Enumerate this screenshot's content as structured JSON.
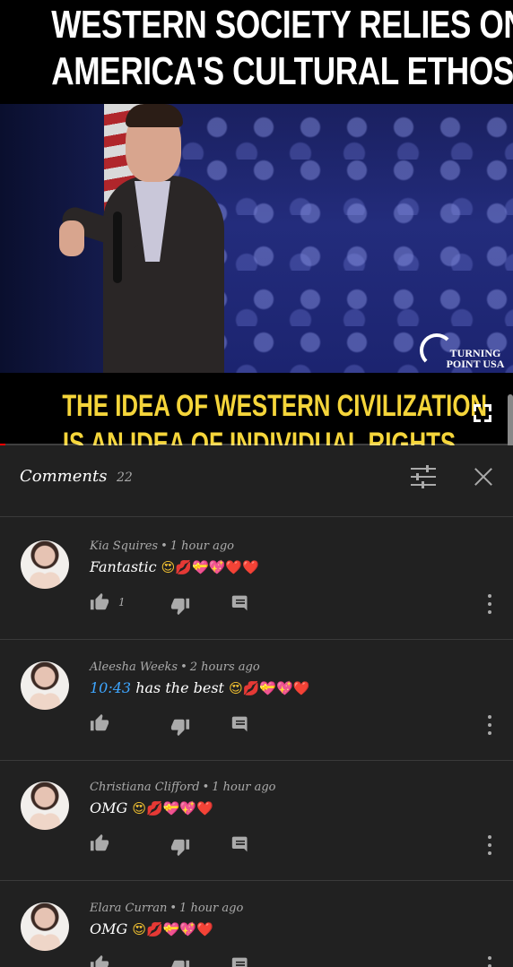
{
  "video": {
    "headline_line1": "WESTERN SOCIETY RELIES ON",
    "headline_line2": "AMERICA'S CULTURAL ETHOS",
    "caption_line1": "THE IDEA OF WESTERN CIVILIZATION",
    "caption_line2": "IS AN IDEA OF INDIVIDUAL RIGHTS",
    "logo_line1": "TURNING",
    "logo_line2": "POINT USA",
    "progress": 0.01
  },
  "comments_panel": {
    "title": "Comments",
    "count": "22",
    "icons": {
      "sort": "sort-sliders-icon",
      "close": "close-icon"
    }
  },
  "comments": [
    {
      "author": "Kia Squires",
      "time": "1 hour ago",
      "text": "Fantastic",
      "timestamp_link": "",
      "emojis": [
        "😍",
        "💋",
        "💝",
        "💖",
        "❤️",
        "❤️"
      ],
      "likes": "1"
    },
    {
      "author": "Aleesha Weeks",
      "time": "2 hours ago",
      "text": "has the best",
      "timestamp_link": "10:43",
      "emojis": [
        "😍",
        "💋",
        "💝",
        "💖",
        "❤️"
      ],
      "likes": ""
    },
    {
      "author": "Christiana Clifford",
      "time": "1 hour ago",
      "text": "OMG",
      "timestamp_link": "",
      "emojis": [
        "😍",
        "💋",
        "💝",
        "💖",
        "❤️"
      ],
      "likes": ""
    },
    {
      "author": "Elara Curran",
      "time": "1 hour ago",
      "text": "OMG",
      "timestamp_link": "",
      "emojis": [
        "😍",
        "💋",
        "💝",
        "💖",
        "❤️"
      ],
      "likes": ""
    }
  ],
  "separator": "•",
  "colors": {
    "background": "#212121",
    "caption_yellow": "#f5d53a",
    "link_blue": "#3ea6ff",
    "progress_red": "#ff0000"
  }
}
